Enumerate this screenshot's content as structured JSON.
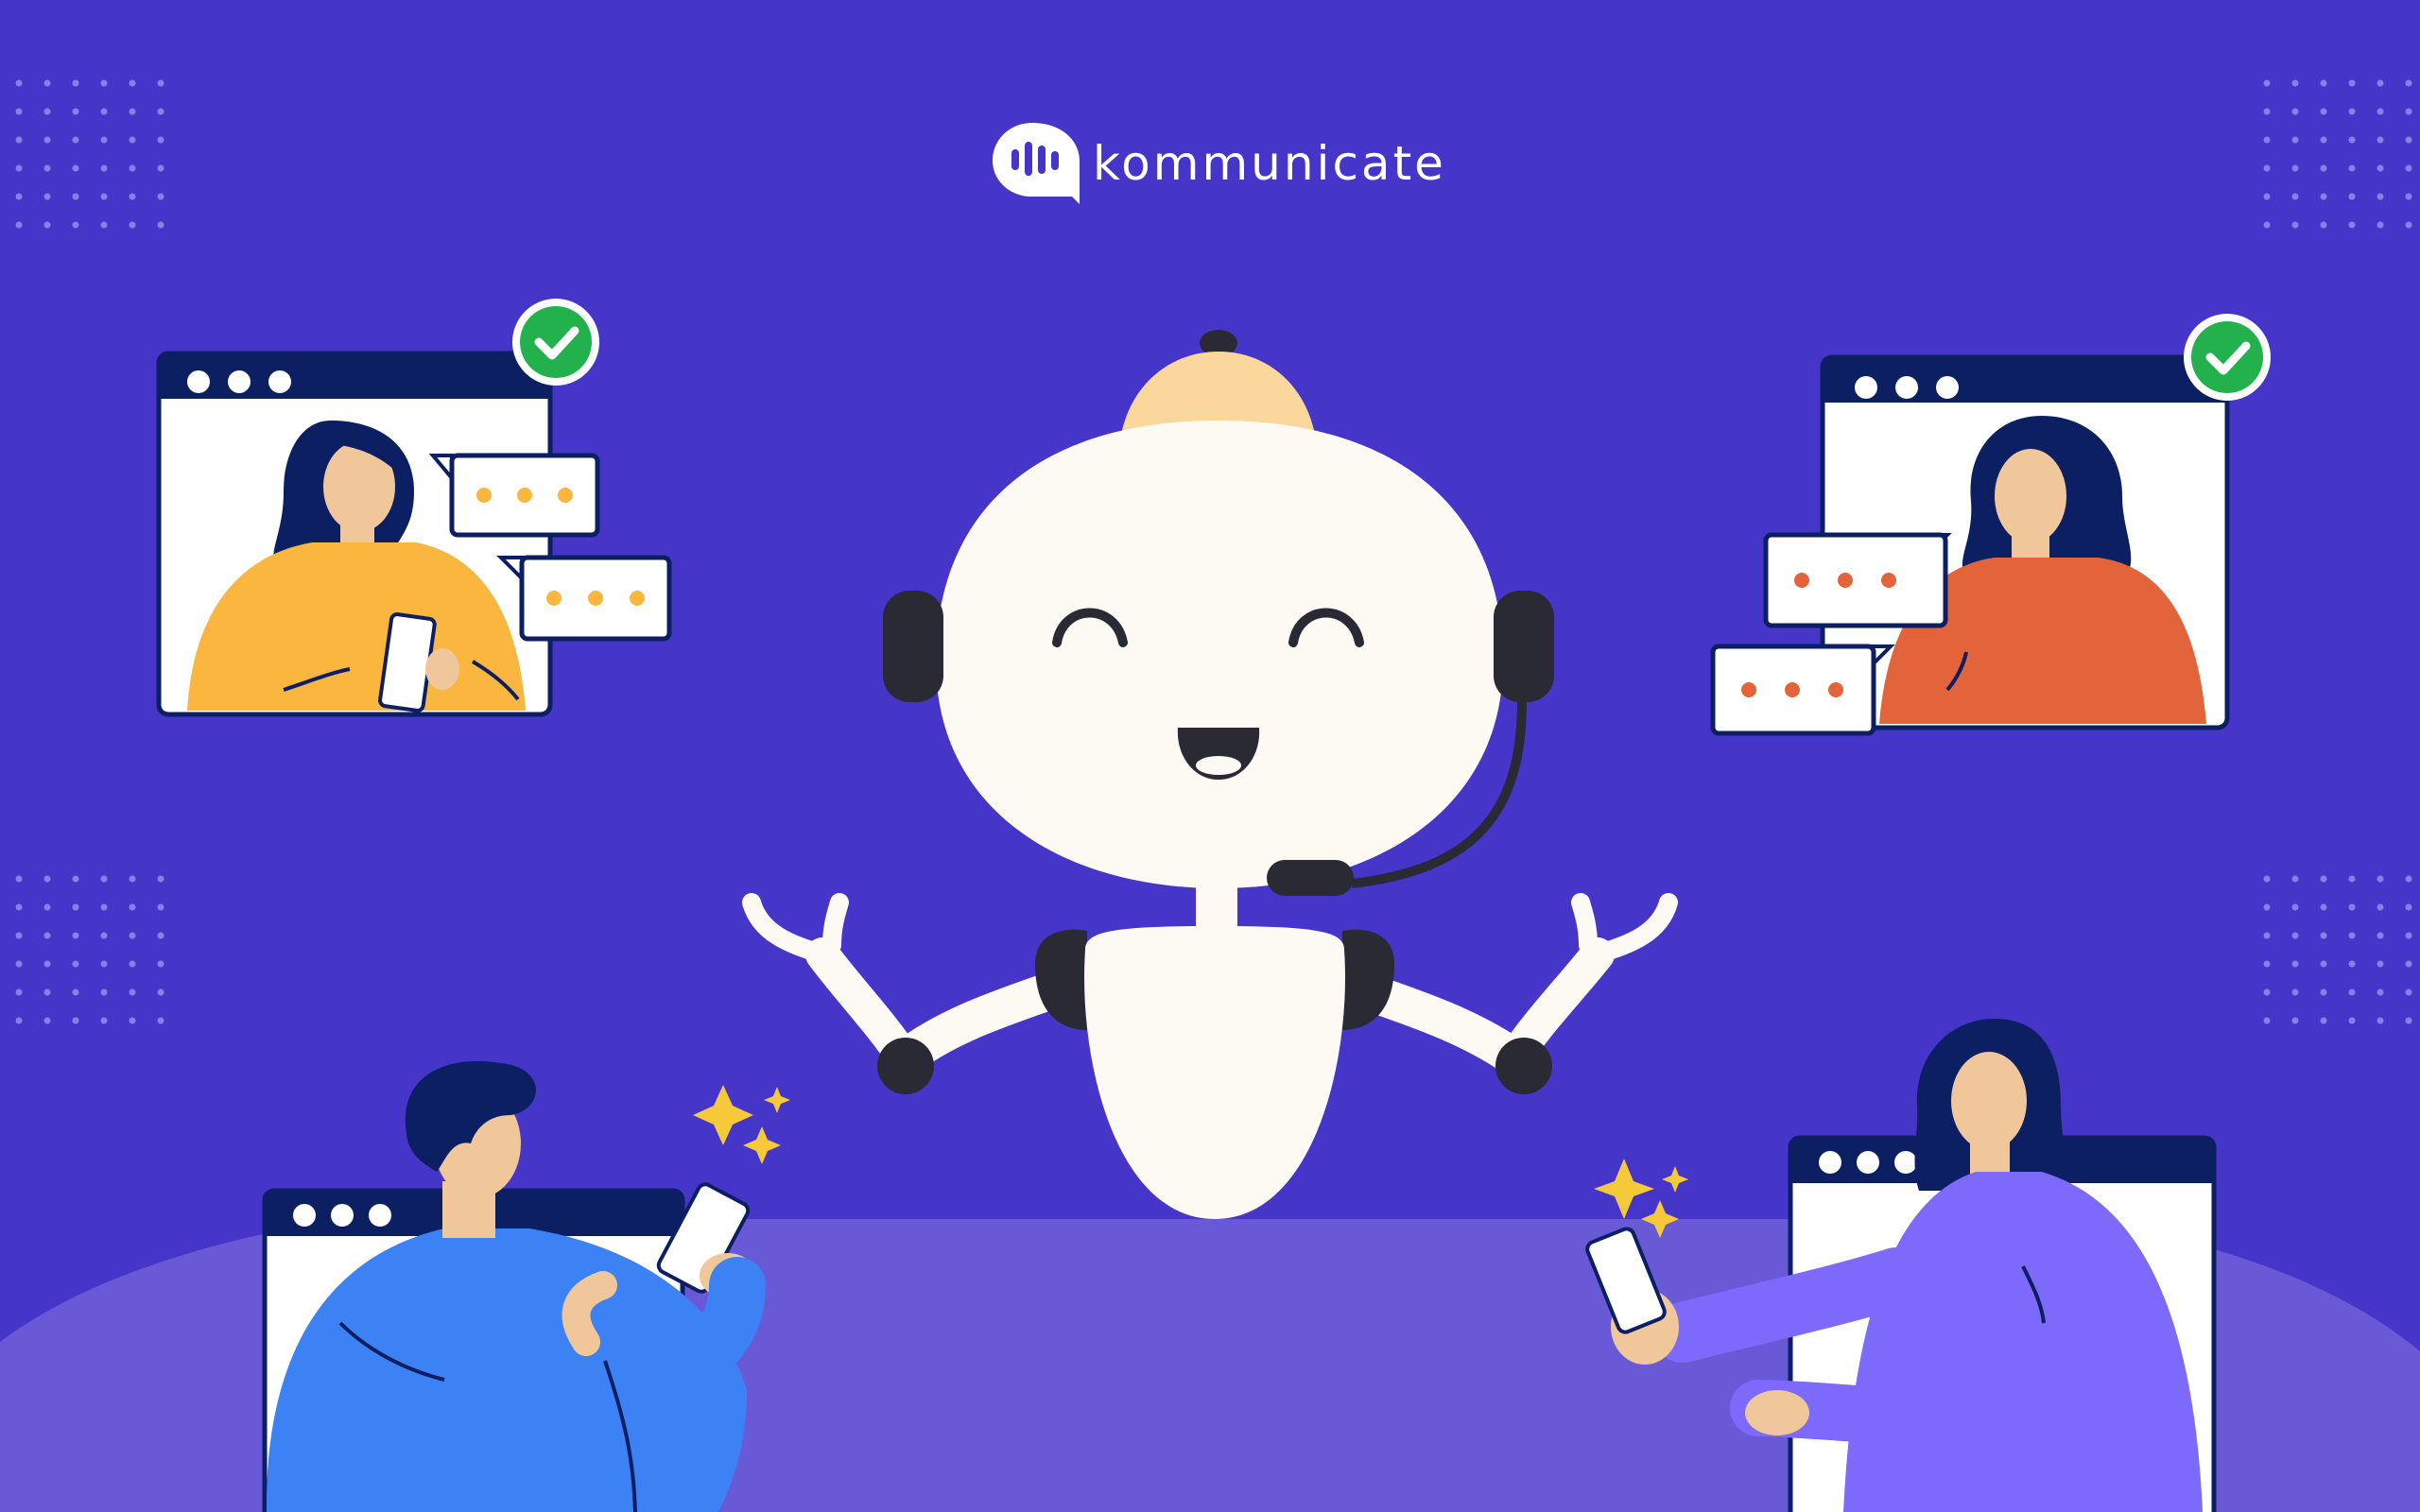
{
  "brand": {
    "name": "kommunicate",
    "logo_icon": "speech-bubble-logo-icon"
  },
  "colors": {
    "background": "#4536c9",
    "table": "#6a59d6",
    "window_bar": "#0d1f63",
    "check_badge": "#22b14c",
    "robot_body": "#fdfaf3",
    "robot_cap": "#fad79c",
    "yellow_shirt": "#fbb63f",
    "orange_shirt": "#e3643b",
    "blue_shirt": "#3d82f5",
    "violet_shirt": "#7d69fb",
    "sparkle": "#f6c93a"
  },
  "icons": [
    "check-icon",
    "typing-dots-icon",
    "sparkle-icon",
    "phone-icon",
    "headset-icon"
  ]
}
